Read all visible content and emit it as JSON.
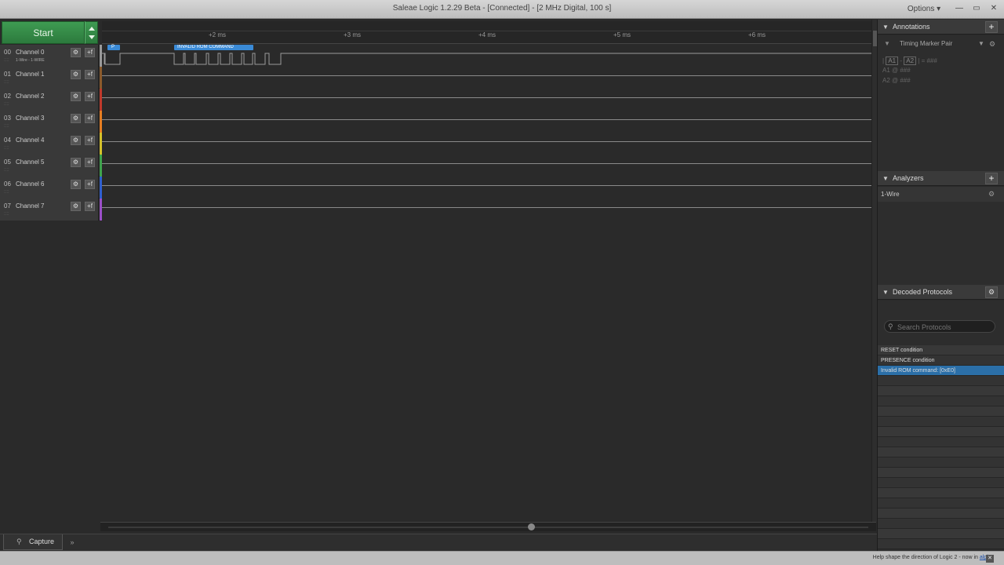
{
  "window": {
    "title": "Saleae Logic 1.2.29 Beta - [Connected] - [2 MHz Digital, 100 s]",
    "options_label": "Options ▾",
    "minimize": "—",
    "restore": "▭",
    "close": "✕"
  },
  "capture": {
    "start_label": "Start"
  },
  "ruler": {
    "ticks": [
      "+2 ms",
      "+3 ms",
      "+4 ms",
      "+5 ms",
      "+6 ms"
    ]
  },
  "channels": [
    {
      "num": "00",
      "name": "Channel 0",
      "sub": "1-Wire - 1-WIRE",
      "color": "#9a9a9a"
    },
    {
      "num": "01",
      "name": "Channel 1",
      "sub": "",
      "color": "#8b5a2b"
    },
    {
      "num": "02",
      "name": "Channel 2",
      "sub": "",
      "color": "#c0392b"
    },
    {
      "num": "03",
      "name": "Channel 3",
      "sub": "",
      "color": "#e67e22"
    },
    {
      "num": "04",
      "name": "Channel 4",
      "sub": "",
      "color": "#d4c12a"
    },
    {
      "num": "05",
      "name": "Channel 5",
      "sub": "",
      "color": "#3fa34d"
    },
    {
      "num": "06",
      "name": "Channel 6",
      "sub": "",
      "color": "#2f5fd0"
    },
    {
      "num": "07",
      "name": "Channel 7",
      "sub": "",
      "color": "#9b4fc8"
    }
  ],
  "decoded_bubbles": {
    "presence": "P",
    "command": "INVALID ROM COMMAND"
  },
  "tabs": {
    "capture": "Capture",
    "more": "»"
  },
  "status": {
    "message": "Help shape the direction of Logic 2 - now in ",
    "link": "alpha",
    "close": "✕"
  },
  "annotations": {
    "title": "Annotations",
    "add": "+",
    "marker_pair": "Timing Marker Pair",
    "line1_a1": "A1",
    "line1_a2": "A2",
    "line1_prefix": "|",
    "line1_dash": "-",
    "line1_eq": "| = ###",
    "a1_label": "A1  @  ###",
    "a2_label": "A2  @  ###"
  },
  "analyzers": {
    "title": "Analyzers",
    "add": "+",
    "items": [
      "1-Wire"
    ]
  },
  "decoded_protocols": {
    "title": "Decoded Protocols",
    "search_placeholder": "Search Protocols",
    "rows": [
      "RESET condition",
      "PRESENCE condition",
      "Invalid ROM command: [0xE0]"
    ],
    "selected_index": 2
  },
  "icons": {
    "gear": "gear-icon",
    "trigger": "trigger-icon",
    "search": "search-icon",
    "funnel": "filter-icon"
  }
}
